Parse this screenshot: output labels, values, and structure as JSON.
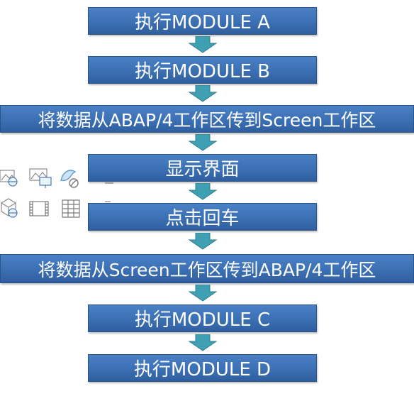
{
  "steps": [
    {
      "label": "执行MODULE A"
    },
    {
      "label": "执行MODULE B"
    },
    {
      "label": "将数据从ABAP/4工作区传到Screen工作区"
    },
    {
      "label": "显示界面"
    },
    {
      "label": "点击回车"
    },
    {
      "label": "将数据从Screen工作区传到ABAP/4工作区"
    },
    {
      "label": "执行MODULE C"
    },
    {
      "label": "执行MODULE D"
    }
  ],
  "colors": {
    "box_fill": "#3c70b4",
    "box_border": "#2a5488",
    "box_text": "#ffffff",
    "arrow_fill": "#3fa0b4",
    "arrow_stroke": "#2e7f8f"
  },
  "background_icons": [
    "image-globe-icon",
    "image-monitor-icon",
    "bird-icon",
    "cube-globe-icon",
    "film-strip-icon",
    "table-grid-icon"
  ]
}
